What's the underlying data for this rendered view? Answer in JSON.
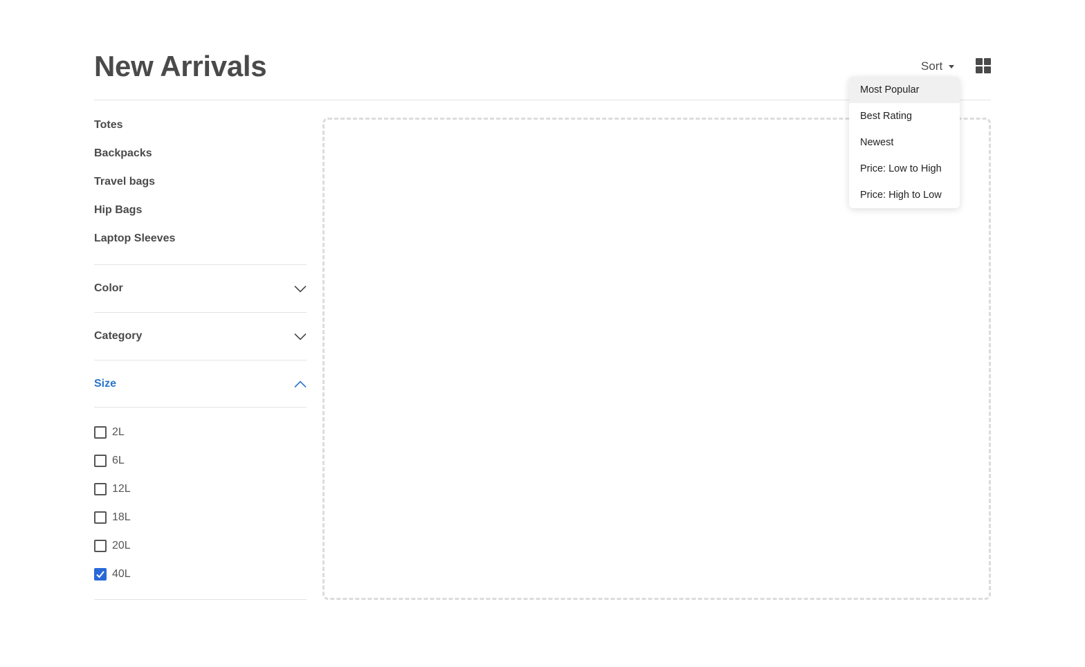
{
  "header": {
    "title": "New Arrivals",
    "sort_label": "Sort"
  },
  "categories": [
    "Totes",
    "Backpacks",
    "Travel bags",
    "Hip Bags",
    "Laptop Sleeves"
  ],
  "filters": {
    "color_label": "Color",
    "category_label": "Category",
    "size_label": "Size",
    "size_options": [
      {
        "label": "2L",
        "checked": false
      },
      {
        "label": "6L",
        "checked": false
      },
      {
        "label": "12L",
        "checked": false
      },
      {
        "label": "18L",
        "checked": false
      },
      {
        "label": "20L",
        "checked": false
      },
      {
        "label": "40L",
        "checked": true
      }
    ]
  },
  "sort_menu": {
    "options": [
      "Most Popular",
      "Best Rating",
      "Newest",
      "Price: Low to High",
      "Price: High to Low"
    ],
    "highlighted": "Most Popular"
  },
  "colors": {
    "text": "#4a4a4a",
    "accent": "#2a74c9",
    "checkbox_checked": "#2a68d7",
    "divider": "#e3e3e3"
  },
  "icons": {
    "sort_caret": "caret-down-icon",
    "grid_view": "grid-icon",
    "collapsed": "chevron-down-icon",
    "expanded": "chevron-up-icon",
    "check": "check-icon"
  }
}
